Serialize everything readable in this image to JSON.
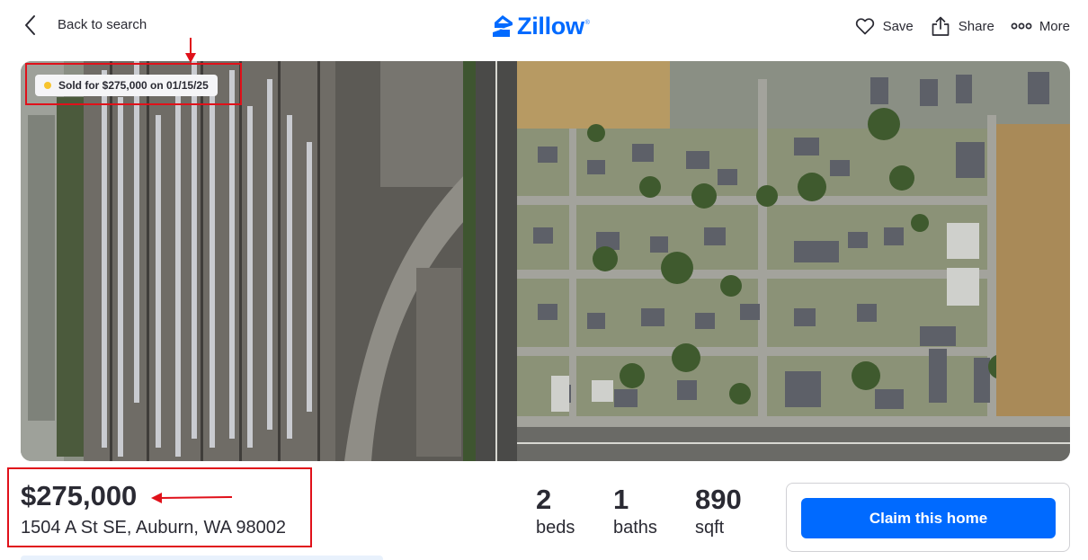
{
  "header": {
    "back_label": "Back to search",
    "logo_text": "Zillow",
    "logo_tm": "®",
    "actions": [
      {
        "label": "Save",
        "icon": "heart-icon"
      },
      {
        "label": "Share",
        "icon": "share-icon"
      },
      {
        "label": "More",
        "icon": "more-icon"
      }
    ]
  },
  "photo": {
    "sold_badge": "Sold for $275,000 on 01/15/25",
    "sold_dot_color": "#f7c42e"
  },
  "listing": {
    "price": "$275,000",
    "address": "1504 A St SE, Auburn, WA 98002",
    "stats": [
      {
        "value": "2",
        "label": "beds"
      },
      {
        "value": "1",
        "label": "baths"
      },
      {
        "value": "890",
        "label": "sqft"
      }
    ]
  },
  "claim": {
    "button_label": "Claim this home"
  },
  "colors": {
    "brand": "#006aff",
    "annotation": "#e0111a",
    "text": "#2a2a33"
  }
}
